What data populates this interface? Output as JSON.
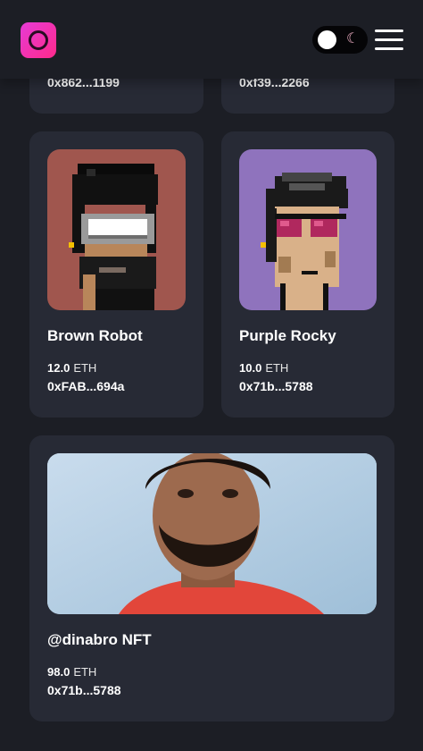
{
  "header": {
    "logo_icon": "logo-icon",
    "theme_toggle_icon": "moon-icon",
    "menu_icon": "hamburger-menu-icon"
  },
  "top_cards": [
    {
      "address": "0x862...1199"
    },
    {
      "address": "0xf39...2266"
    }
  ],
  "cards": [
    {
      "title": "Brown Robot",
      "price": "12.0",
      "unit": "ETH",
      "address": "0xFAB...694a",
      "bg": "#a0564e"
    },
    {
      "title": "Purple Rocky",
      "price": "10.0",
      "unit": "ETH",
      "address": "0x71b...5788",
      "bg": "#8f73bd"
    },
    {
      "title": "@dinabro NFT",
      "price": "98.0",
      "unit": "ETH",
      "address": "0x71b...5788",
      "bg": "#b9d2e4"
    }
  ],
  "colors": {
    "background": "#1c1e25",
    "card": "#272a35",
    "accent": "#ff2a8a"
  }
}
